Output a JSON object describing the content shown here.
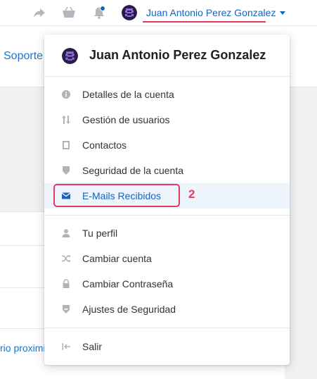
{
  "topbar": {
    "icons": [
      "share-icon",
      "basket-icon",
      "bell-icon"
    ],
    "user_name": "Juan Antonio Perez Gonzalez"
  },
  "page": {
    "soporte_link": "Soporte",
    "partial_link_text": "rio proximi"
  },
  "menu": {
    "header_name": "Juan Antonio Perez Gonzalez",
    "group1": [
      {
        "label": "Detalles de la cuenta",
        "icon": "info-icon"
      },
      {
        "label": "Gestión de usuarios",
        "icon": "sort-arrows-icon"
      },
      {
        "label": "Contactos",
        "icon": "contact-book-icon"
      },
      {
        "label": "Seguridad de la cuenta",
        "icon": "shield-icon"
      },
      {
        "label": "E-Mails Recibidos",
        "icon": "envelope-icon",
        "selected": true
      }
    ],
    "group2": [
      {
        "label": "Tu perfil",
        "icon": "user-icon"
      },
      {
        "label": "Cambiar cuenta",
        "icon": "shuffle-icon"
      },
      {
        "label": "Cambiar Contraseña",
        "icon": "lock-icon"
      },
      {
        "label": "Ajustes de Seguridad",
        "icon": "shield-minus-icon"
      }
    ],
    "group3": [
      {
        "label": "Salir",
        "icon": "logout-icon"
      }
    ]
  },
  "annotation": {
    "step_number": "2"
  },
  "colors": {
    "accent": "#1565c0",
    "highlight": "#e53963",
    "selected_bg": "#eef4fb"
  }
}
